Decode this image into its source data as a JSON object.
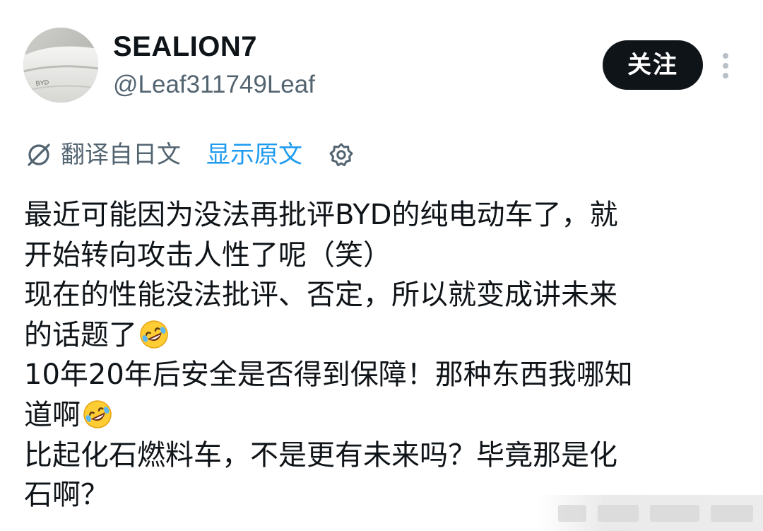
{
  "profile": {
    "display_name": "SEALION7",
    "handle": "@Leaf311749Leaf",
    "avatar_badge_text": "BYD"
  },
  "actions": {
    "follow_label": "关注",
    "more_icon": "more-vertical-icon"
  },
  "translation": {
    "icon": "translate-icon",
    "label": "翻译自日文",
    "show_original_label": "显示原文",
    "settings_icon": "gear-icon",
    "link_color": "#1d9bf0"
  },
  "post": {
    "lines": [
      "最近可能因为没法再批评BYD的纯电动车了，就",
      "开始转向攻击人性了呢（笑）",
      "现在的性能没法批评、否定，所以就变成讲未来",
      "的话题了",
      "10年20年后安全是否得到保障！那种东西我哪知",
      "道啊",
      "比起化石燃料车，不是更有未来吗？毕竟那是化",
      "石啊？"
    ],
    "emoji": "rolling-on-floor-laughing-emoji"
  },
  "colors": {
    "text_primary": "#0f1419",
    "text_secondary": "#536471",
    "button_bg": "#0f1419",
    "button_text": "#ffffff"
  }
}
